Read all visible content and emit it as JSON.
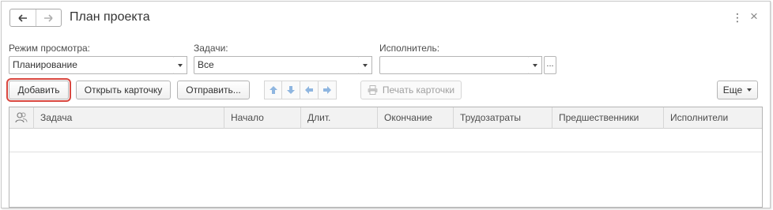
{
  "window": {
    "title": "План проекта",
    "more_icon": "⋮",
    "close_icon": "×"
  },
  "filters": {
    "view_mode": {
      "label": "Режим просмотра:",
      "value": "Планирование"
    },
    "tasks": {
      "label": "Задачи:",
      "value": "Все"
    },
    "executor": {
      "label": "Исполнитель:",
      "value": "",
      "dots": "..."
    }
  },
  "toolbar": {
    "add_label": "Добавить",
    "open_card_label": "Открыть карточку",
    "send_label": "Отправить...",
    "print_card_label": "Печать карточки",
    "more_label": "Еще"
  },
  "table": {
    "columns": [
      "Задача",
      "Начало",
      "Длит.",
      "Окончание",
      "Трудозатраты",
      "Предшественники",
      "Исполнители"
    ]
  },
  "colors": {
    "accent_highlight": "#d9473f",
    "arrow_blue": "#8fb6e0"
  }
}
